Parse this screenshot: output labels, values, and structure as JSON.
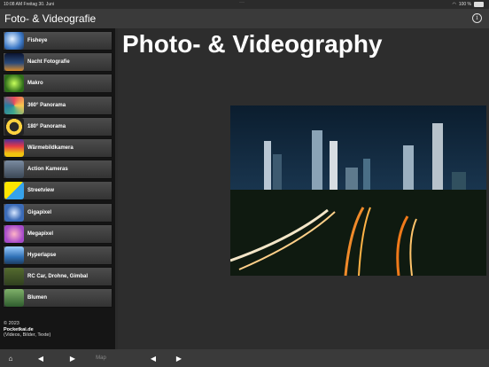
{
  "status": {
    "time": "10:08 AM",
    "date": "Freitag 30. Juni",
    "battery": "100 %"
  },
  "header": {
    "title": "Foto- & Videografie",
    "info_icon": "info-icon"
  },
  "sidebar": {
    "items": [
      {
        "label": "Fisheye",
        "icon": "fisheye-thumb"
      },
      {
        "label": "Nacht Fotografie",
        "icon": "night-photo-thumb"
      },
      {
        "label": "Makro",
        "icon": "macro-thumb"
      },
      {
        "label": "360° Panorama",
        "icon": "panorama-360-thumb"
      },
      {
        "label": "180° Panorama",
        "icon": "panorama-180-thumb"
      },
      {
        "label": "Wärmebildkamera",
        "icon": "thermal-camera-thumb"
      },
      {
        "label": "Action Kameras",
        "icon": "action-camera-thumb"
      },
      {
        "label": "Streetview",
        "icon": "streetview-thumb"
      },
      {
        "label": "Gigapixel",
        "icon": "gigapixel-thumb"
      },
      {
        "label": "Megapixel",
        "icon": "megapixel-thumb"
      },
      {
        "label": "Hyperlapse",
        "icon": "hyperlapse-thumb"
      },
      {
        "label": "RC Car, Drohne, Gimbal",
        "icon": "rc-car-thumb"
      },
      {
        "label": "Blumen",
        "icon": "flowers-thumb"
      }
    ],
    "footer": {
      "copyright": "© 2023",
      "site": "Pocketkai.de",
      "note": "(Videos, Bilder, Texte)"
    }
  },
  "main": {
    "heading": "Photo- & Videography"
  },
  "toolbar": {
    "map_label": "Map"
  }
}
